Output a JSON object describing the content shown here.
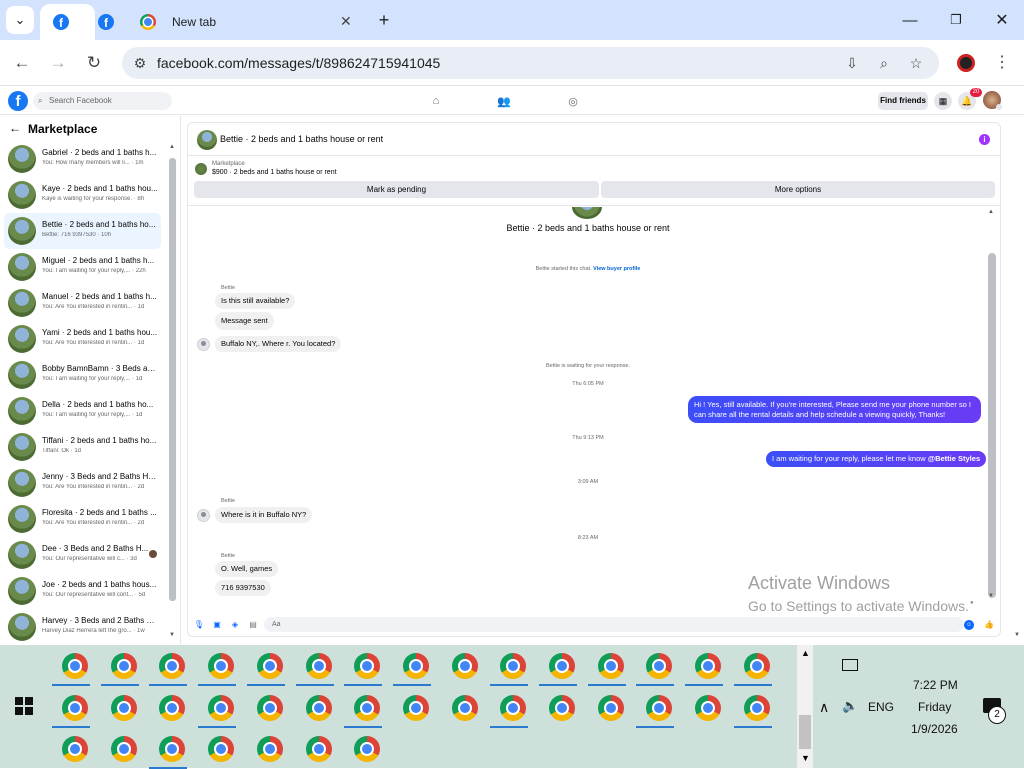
{
  "browser": {
    "tabs": [
      {
        "title": "",
        "icon": "facebook-icon",
        "active": true
      },
      {
        "title": "",
        "icon": "facebook-icon",
        "active": false
      },
      {
        "title": "New tab",
        "icon": "chrome-icon",
        "active": false
      }
    ],
    "url": "facebook.com/messages/t/898624715941045"
  },
  "fb": {
    "search_placeholder": "Search Facebook",
    "find_friends": "Find friends",
    "notifications_badge": "20"
  },
  "sidebar": {
    "title": "Marketplace",
    "conversations": [
      {
        "name": "Gabriel · 2 beds and 1 baths h...",
        "snippet": "You: How many members will li... · 1m"
      },
      {
        "name": "Kaye · 2 beds and 1 baths hou...",
        "snippet": "Kaye is waiting for your response. · 8h"
      },
      {
        "name": "Bettie · 2 beds and 1 baths ho...",
        "snippet": "Bettie: 716 9397530 · 10h",
        "selected": true
      },
      {
        "name": "Miguel · 2 beds and 1 baths h...",
        "snippet": "You: I am waiting for your reply,... · 22h"
      },
      {
        "name": "Manuel · 2 beds and 1 baths h...",
        "snippet": "You: Are You interested in rentin... · 1d"
      },
      {
        "name": "Yami · 2 beds and 1 baths hou...",
        "snippet": "You: Are You interested in rentin... · 1d"
      },
      {
        "name": "Bobby BamnBamn · 3 Beds an...",
        "snippet": "You: I am waiting for your reply,... · 1d"
      },
      {
        "name": "Della · 2 beds and 1 baths ho...",
        "snippet": "You: I am waiting for your reply,... · 1d"
      },
      {
        "name": "Tiffani · 2 beds and 1 baths ho...",
        "snippet": "Tiffani: Ok · 1d"
      },
      {
        "name": "Jenny · 3 Beds and 2 Baths Ho...",
        "snippet": "You: Are You interested in rentin... · 2d"
      },
      {
        "name": "Floresita · 2 beds and 1 baths ...",
        "snippet": "You: Are You interested in rentin... · 2d"
      },
      {
        "name": "Dee · 3 Beds and 2 Baths H...",
        "snippet": "You: Our representative will c... · 3d"
      },
      {
        "name": "Joe · 2 beds and 1 baths hous...",
        "snippet": "You: Our representative will cont... · 5d"
      },
      {
        "name": "Harvey · 3 Beds and 2 Baths H...",
        "snippet": "Harvey Diaz Herrera left the gro... · 1w"
      }
    ]
  },
  "chat": {
    "title": "Bettie · 2 beds and 1 baths house or rent",
    "listing_source": "Marketplace",
    "listing_desc": "$900 · 2 beds and 1 baths house or rent",
    "mark_pending": "Mark as pending",
    "more_options": "More options",
    "thread_title": "Bettie · 2 beds and 1 baths house or rent",
    "started_text": "Bettie started this chat.",
    "view_profile": "View buyer profile",
    "sender1": "Bettie",
    "msg1": "Is this still available?",
    "msg2": "Message sent",
    "msg3": "Buffalo NY,. Where r. You located?",
    "waiting": "Bettie is waiting for your response.",
    "ts1": "Thu 6:05 PM",
    "out1_line1": "Hi ! Yes, still available. If you're interested, Please send me your phone number so I",
    "out1_line2": "can share all the rental details and help schedule a viewing quickly, Thanks!",
    "ts2": "Thu 9:13 PM",
    "out2": "I am waiting for your reply, please let me know",
    "out2_mention": "@Bettie Styles",
    "ts3": "3:09 AM",
    "sender2": "Bettie",
    "msg4": "Where is it in Buffalo NY?",
    "ts4": "8:23 AM",
    "sender3": "Bettie",
    "msg5": "O. Well, games",
    "msg6": "716 9397530",
    "composer_placeholder": "Aa"
  },
  "watermark": {
    "line1": "Activate Windows",
    "line2": "Go to Settings to activate Windows."
  },
  "tray": {
    "lang": "ENG",
    "time": "7:22 PM",
    "day": "Friday",
    "date": "1/9/2026",
    "notif_count": "2"
  }
}
